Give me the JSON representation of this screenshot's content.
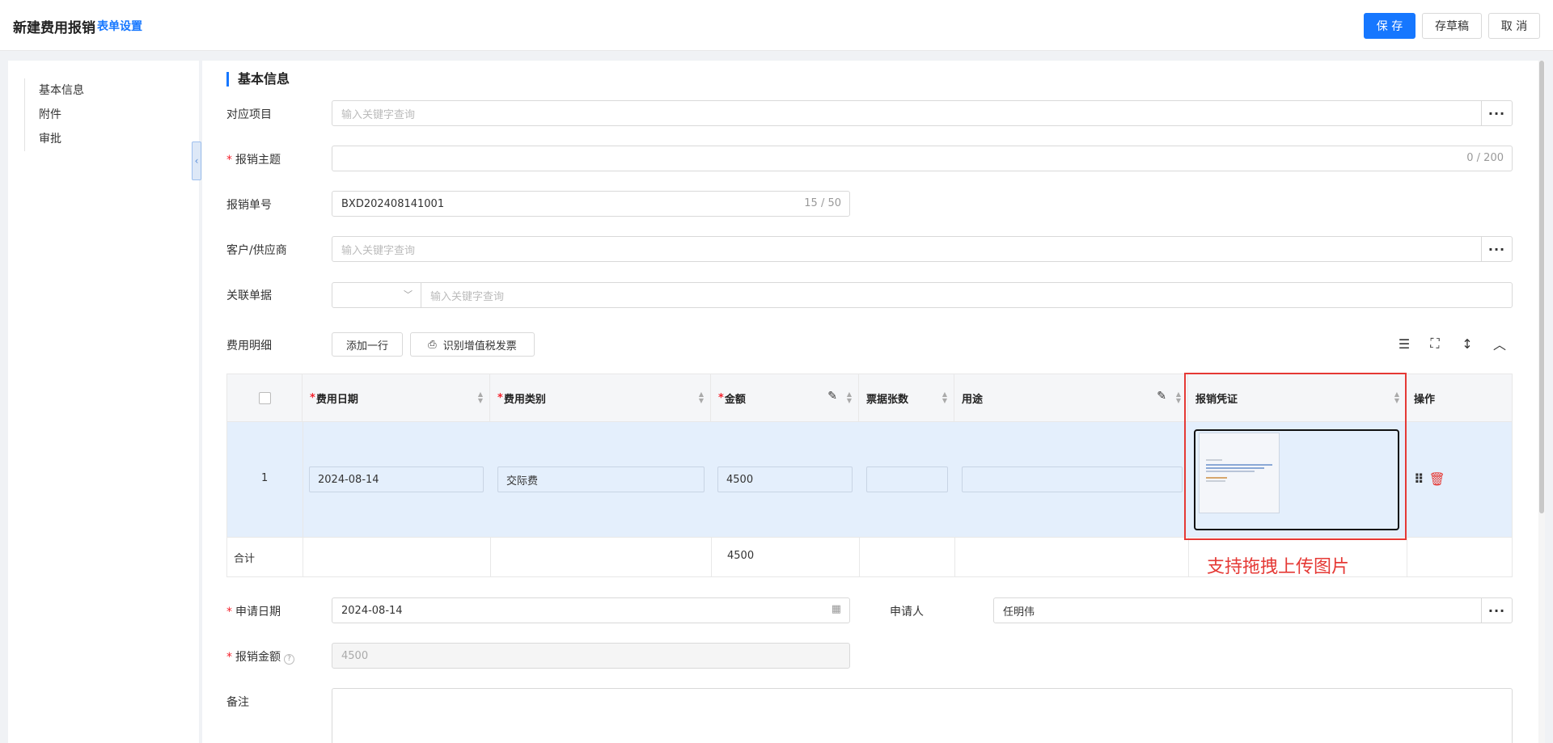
{
  "header": {
    "title": "新建费用报销",
    "form_setting": "表单设置",
    "save": "保 存",
    "draft": "存草稿",
    "cancel": "取 消"
  },
  "sidebar": {
    "items": [
      {
        "label": "基本信息"
      },
      {
        "label": "附件"
      },
      {
        "label": "审批"
      }
    ]
  },
  "section": {
    "title": "基本信息"
  },
  "form": {
    "project": {
      "label": "对应项目",
      "placeholder": "输入关键字查询"
    },
    "subject": {
      "label": "报销主题",
      "value": "",
      "counter": "0 / 200"
    },
    "order_no": {
      "label": "报销单号",
      "value": "BXD202408141001",
      "counter": "15 / 50"
    },
    "customer": {
      "label": "客户/供应商",
      "placeholder": "输入关键字查询"
    },
    "related": {
      "label": "关联单据",
      "placeholder": "输入关键字查询"
    },
    "expense_detail": {
      "label": "费用明细",
      "add_row": "添加一行",
      "recognize_invoice": "识别增值税发票"
    },
    "apply_date": {
      "label": "申请日期",
      "value": "2024-08-14"
    },
    "applicant": {
      "label": "申请人",
      "value": "任明伟"
    },
    "amount": {
      "label": "报销金额",
      "value": "4500"
    },
    "remark": {
      "label": "备注"
    }
  },
  "table": {
    "headers": {
      "date": "费用日期",
      "category": "费用类别",
      "amount": "金额",
      "tickets": "票据张数",
      "purpose": "用途",
      "voucher": "报销凭证",
      "action": "操作"
    },
    "rows": [
      {
        "index": "1",
        "date": "2024-08-14",
        "category": "交际费",
        "amount": "4500",
        "tickets": "",
        "purpose": ""
      }
    ],
    "summary": {
      "label": "合计",
      "amount": "4500"
    }
  },
  "annotation": {
    "text": "支持拖拽上传图片",
    "color": "#e53935"
  },
  "colors": {
    "primary": "#1677ff",
    "required": "#f5222d",
    "row_selected": "#e4effc"
  }
}
